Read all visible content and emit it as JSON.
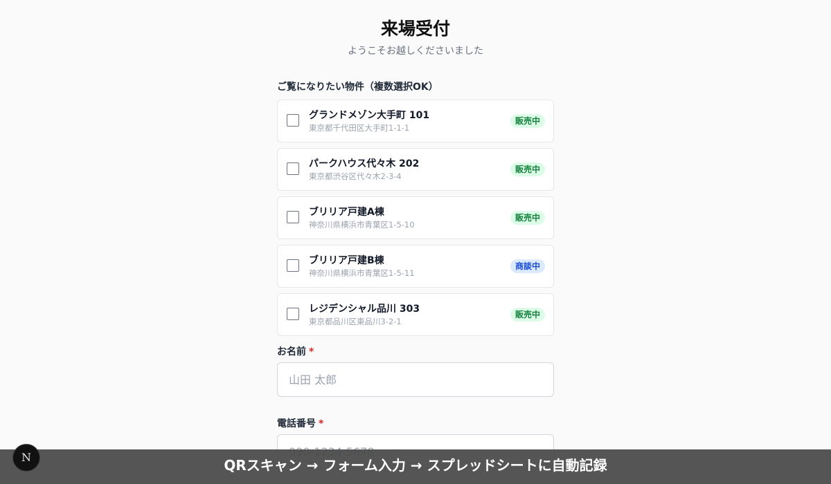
{
  "header": {
    "title": "来場受付",
    "subtitle": "ようこそお越しくださいました"
  },
  "properties_section": {
    "label": "ご覧になりたい物件（複数選択OK）",
    "items": [
      {
        "name": "グランドメゾン大手町 101",
        "address": "東京都千代田区大手町1-1-1",
        "status": "販売中",
        "status_color": "#15803d"
      },
      {
        "name": "パークハウス代々木 202",
        "address": "東京都渋谷区代々木2-3-4",
        "status": "販売中",
        "status_color": "#15803d"
      },
      {
        "name": "ブリリア戸建A棟",
        "address": "神奈川県横浜市青葉区1-5-10",
        "status": "販売中",
        "status_color": "#15803d"
      },
      {
        "name": "ブリリア戸建B棟",
        "address": "神奈川県横浜市青葉区1-5-11",
        "status": "商談中",
        "status_color": "#1d4ed8"
      },
      {
        "name": "レジデンシャル品川 303",
        "address": "東京都品川区東品川3-2-1",
        "status": "販売中",
        "status_color": "#15803d"
      }
    ]
  },
  "form": {
    "name_label": "お名前",
    "name_required_mark": "*",
    "name_placeholder": "山田 太郎",
    "name_value": "",
    "phone_label": "電話番号",
    "phone_required_mark": "*",
    "phone_placeholder": "090-1234-5678",
    "phone_value": ""
  },
  "overlay": {
    "caption": "QRスキャン → フォーム入力 → スプレッドシートに自動記録",
    "badge_letter": "N"
  },
  "colors": {
    "required": "#dc2626",
    "sale_badge_bg": "#dcfce7",
    "negotiation_badge_bg": "#dbeafe"
  }
}
